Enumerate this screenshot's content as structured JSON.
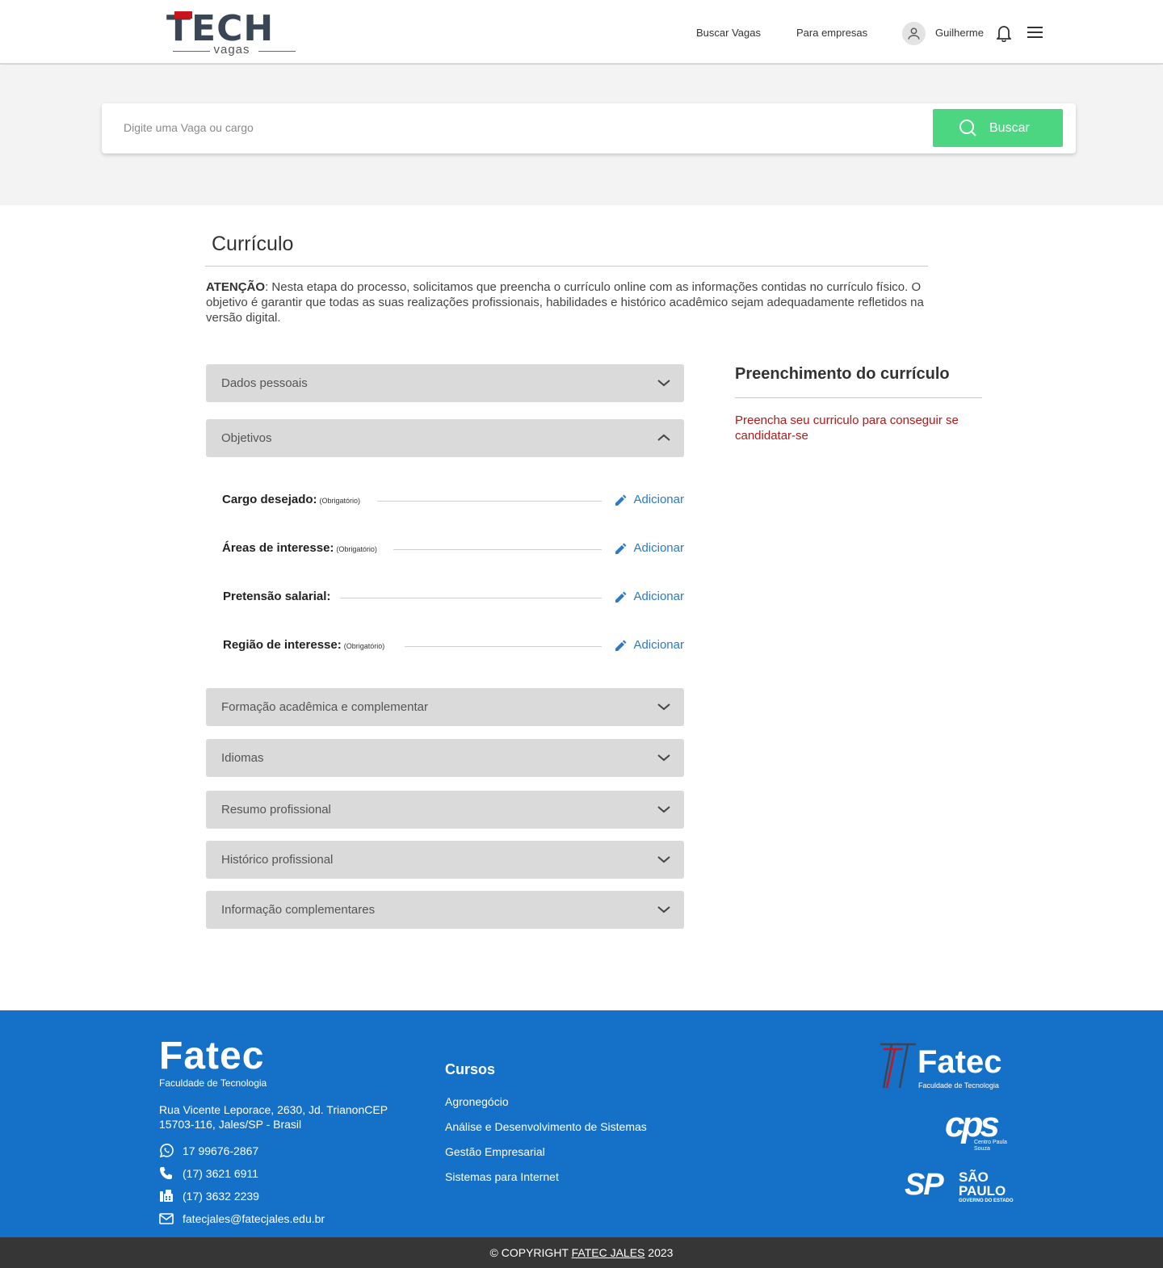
{
  "header": {
    "logo_main": "TECH",
    "logo_sub": "vagas",
    "nav": {
      "buscar": "Buscar Vagas",
      "empresas": "Para empresas"
    },
    "user_name": "Guilherme"
  },
  "search": {
    "placeholder": "Digite uma Vaga ou cargo",
    "button_label": "Buscar"
  },
  "main": {
    "title": "Currículo",
    "attention_label": "ATENÇÃO",
    "attention_text": ": Nesta etapa do processo, solicitamos que preencha o currículo online com as informações contidas no currículo físico. O objetivo é garantir que todas as suas realizações profissionais, habilidades e histórico acadêmico sejam adequadamente refletidos na versão digital.",
    "sections": [
      {
        "label": "Dados pessoais",
        "expanded": false
      },
      {
        "label": "Objetivos",
        "expanded": true
      },
      {
        "label": "Formação acadêmica e complementar",
        "expanded": false
      },
      {
        "label": "Idiomas",
        "expanded": false
      },
      {
        "label": "Resumo profissional",
        "expanded": false
      },
      {
        "label": "Histórico profissional",
        "expanded": false
      },
      {
        "label": "Informação complementares",
        "expanded": false
      }
    ],
    "objectives": [
      {
        "label": "Cargo desejado:",
        "required": "(Obrigatório)",
        "action": "Adicionar"
      },
      {
        "label": "Áreas de interesse:",
        "required": "(Obrigatório)",
        "action": "Adicionar"
      },
      {
        "label": "Pretensão salarial:",
        "required": "",
        "action": "Adicionar"
      },
      {
        "label": "Região de interesse:",
        "required": "(Obrigatório)",
        "action": "Adicionar"
      }
    ]
  },
  "sidebar": {
    "title": "Preenchimento do currículo",
    "message": "Preencha seu curriculo para conseguir se candidatar-se"
  },
  "footer": {
    "logo_main": "Fatec",
    "logo_sub": "Faculdade de Tecnologia",
    "address": "Rua Vicente Leporace, 2630, Jd. TrianonCEP 15703-116, Jales/SP - Brasil",
    "whatsapp": "17 99676-2867",
    "phone": "(17) 3621 6911",
    "fax": "(17) 3632 2239",
    "email": "fatecjales@fatecjales.edu.br",
    "courses_title": "Cursos",
    "courses": [
      "Agronegócio",
      "Análise e Desenvolvimento de Sistemas",
      "Gestão Empresarial",
      "Sistemas para Internet"
    ],
    "partner_fatec": "Fatec",
    "partner_fatec_sub": "Faculdade de Tecnologia",
    "partner_cps": "cps",
    "partner_cps_sub": "Centro Paula Souza",
    "partner_sp": "SP",
    "partner_sp_name": "SÃO PAULO",
    "partner_sp_sub": "GOVERNO DO ESTADO"
  },
  "copyright": {
    "prefix": "© COPYRIGHT ",
    "link": "FATEC JALES",
    "year": " 2023"
  },
  "colors": {
    "accent_green": "#4cd681",
    "footer_blue": "#1570c8",
    "link_blue": "#2a7ac7",
    "warning_red": "#b01a1a"
  }
}
